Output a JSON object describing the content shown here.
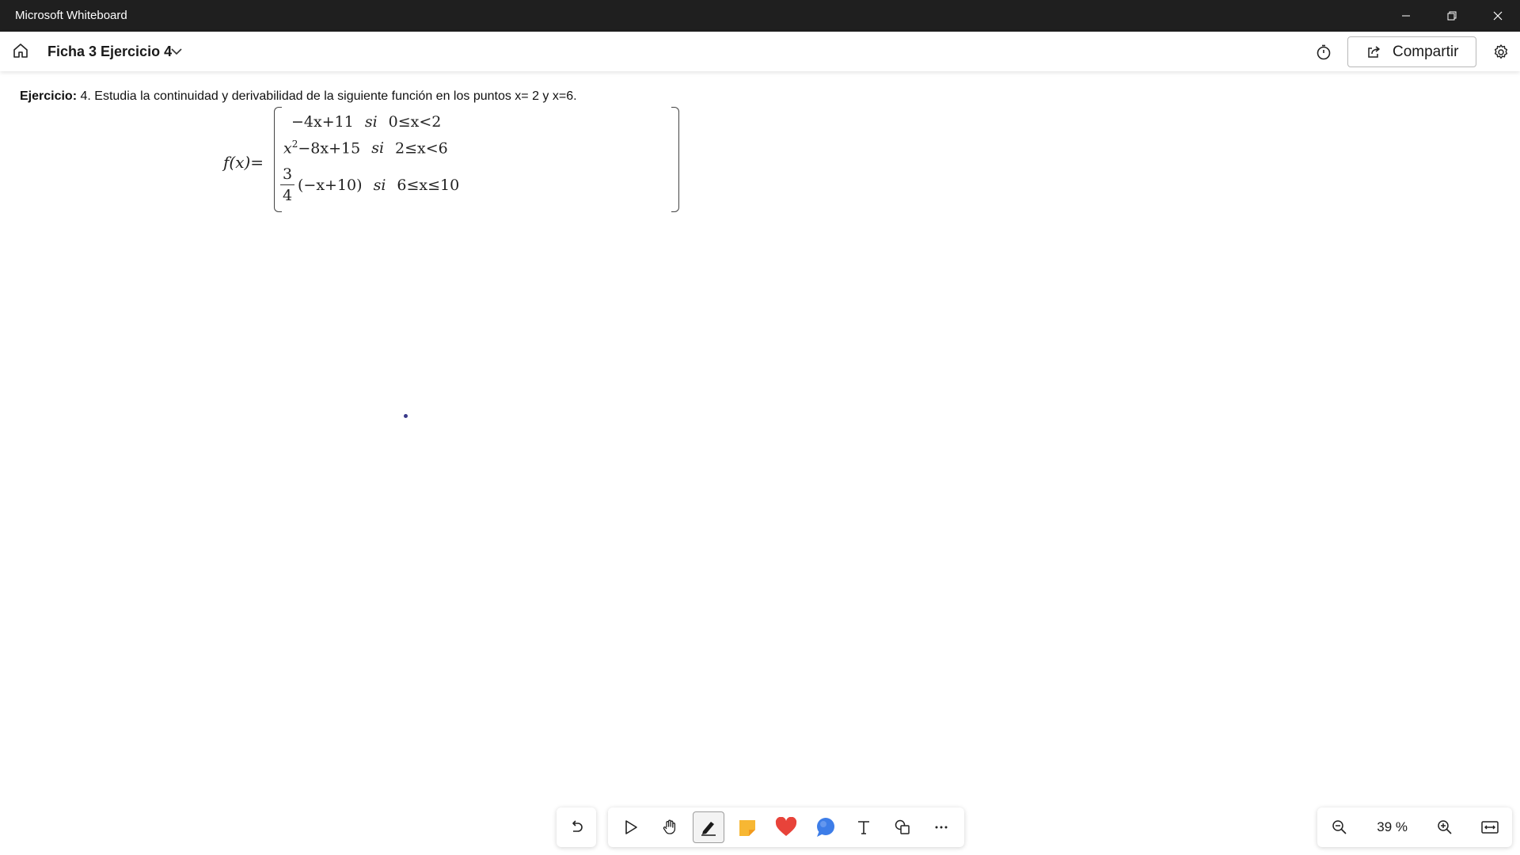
{
  "window": {
    "title": "Microsoft Whiteboard"
  },
  "header": {
    "board_title": "Ficha 3 Ejercicio 4",
    "share_label": "Compartir"
  },
  "canvas": {
    "exercise_label": "Ejercicio:",
    "exercise_text": "4. Estudia la continuidad y derivabilidad de la siguiente función en los puntos x= 2 y x=6.",
    "formula": {
      "lhs": "f(x)=",
      "case1_expr": "−4x+11",
      "case1_si": "si",
      "case1_cond": "0≤x<2",
      "case2_expr_base": "x",
      "case2_expr_exp": "2",
      "case2_expr_rest": "−8x+15",
      "case2_si": "si",
      "case2_cond": "2≤x<6",
      "case3_frac_num": "3",
      "case3_frac_den": "4",
      "case3_expr": "(−x+10)",
      "case3_si": "si",
      "case3_cond": "6≤x≤10"
    }
  },
  "toolbar": {
    "tools": [
      "undo-icon",
      "select-icon",
      "pan-hand-icon",
      "pen-icon",
      "sticky-note-icon",
      "reaction-heart-icon",
      "comment-bubble-icon",
      "text-icon",
      "shapes-icon",
      "more-icon"
    ],
    "active_tool": "pen-icon",
    "colors": {
      "sticky": "#f7b733",
      "heart": "#e8433a",
      "bubble": "#3d7de8"
    }
  },
  "zoom": {
    "level": "39 %"
  }
}
